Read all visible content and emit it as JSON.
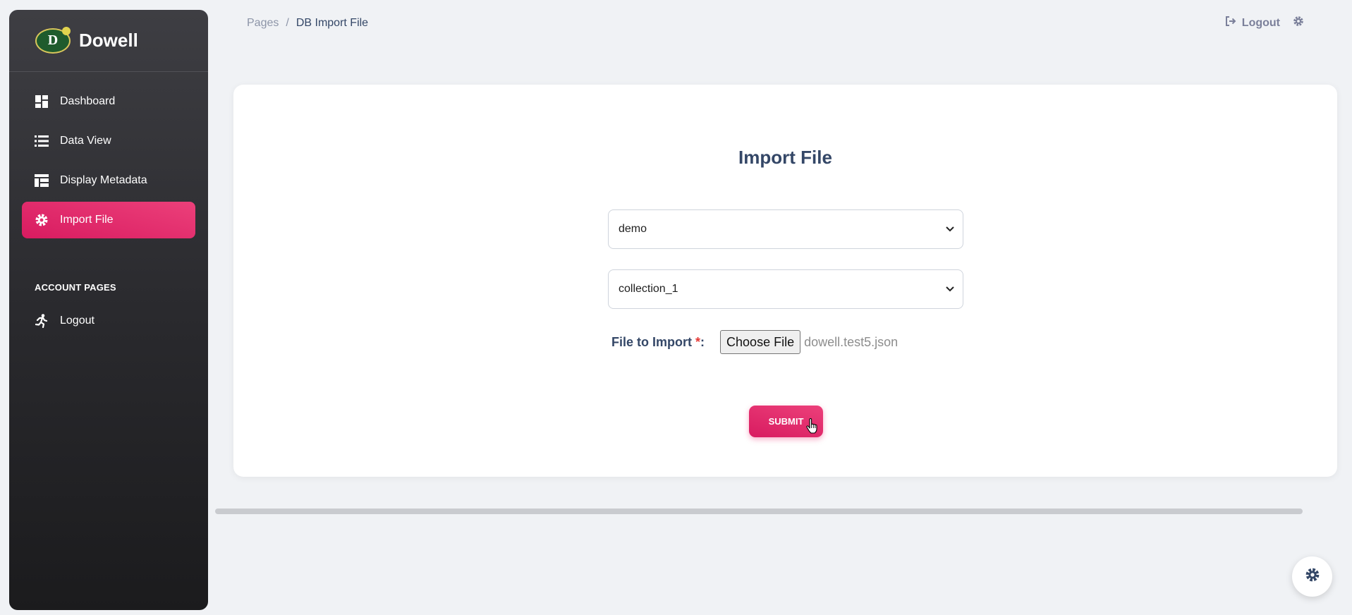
{
  "brand": {
    "name": "Dowell",
    "logo_letter": "D"
  },
  "sidebar": {
    "items": [
      {
        "label": "Dashboard",
        "icon": "dashboard-icon"
      },
      {
        "label": "Data View",
        "icon": "list-icon"
      },
      {
        "label": "Display Metadata",
        "icon": "table-icon"
      },
      {
        "label": "Import File",
        "icon": "gear-icon",
        "active": true
      }
    ],
    "section_title": "ACCOUNT PAGES",
    "account_items": [
      {
        "label": "Logout",
        "icon": "running-person-icon"
      }
    ]
  },
  "breadcrumb": {
    "parent": "Pages",
    "separator": "/",
    "current": "DB Import File"
  },
  "topbar": {
    "logout_label": "Logout"
  },
  "form": {
    "title": "Import File",
    "database_select": "demo",
    "collection_select": "collection_1",
    "file_label": "File to Import",
    "required_mark": "*",
    "label_suffix": ":",
    "choose_button": "Choose File",
    "file_name": "dowell.test5.json",
    "submit_label": "SUBMIT"
  },
  "colors": {
    "accent": "#e91e63",
    "sidebar_bg": "#2a2a2e",
    "page_bg": "#f0f2f5"
  }
}
